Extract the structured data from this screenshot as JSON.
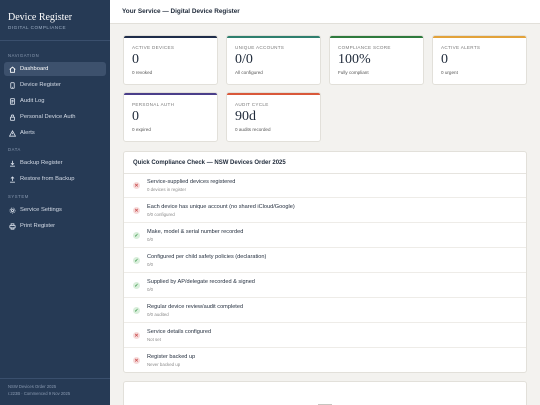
{
  "brand": {
    "title": "Device Register",
    "subtitle": "DIGITAL COMPLIANCE"
  },
  "nav_sections": {
    "navigation": "NAVIGATION",
    "data": "DATA",
    "system": "SYSTEM"
  },
  "nav": {
    "dashboard": "Dashboard",
    "device_register": "Device Register",
    "audit_log": "Audit Log",
    "personal_auth": "Personal Device Auth",
    "alerts": "Alerts",
    "backup": "Backup Register",
    "restore": "Restore from Backup",
    "settings": "Service Settings",
    "print": "Print Register"
  },
  "footer": {
    "line1": "NSW Devices Order 2025",
    "line2": "r.223B · Commenced 9 Nov 2025"
  },
  "header": {
    "title": "Your Service — Digital Device Register"
  },
  "cards": {
    "active_devices": {
      "label": "ACTIVE DEVICES",
      "value": "0",
      "sub": "0 revoked",
      "accent": "#1f2d4a"
    },
    "unique_accounts": {
      "label": "UNIQUE ACCOUNTS",
      "value": "0/0",
      "sub": "All configured",
      "accent": "#2f7f6e"
    },
    "compliance_score": {
      "label": "COMPLIANCE SCORE",
      "value": "100%",
      "sub": "Fully compliant",
      "accent": "#2e7a3d"
    },
    "active_alerts": {
      "label": "ACTIVE ALERTS",
      "value": "0",
      "sub": "0 urgent",
      "accent": "#e2a23a"
    },
    "personal_auth": {
      "label": "PERSONAL AUTH",
      "value": "0",
      "sub": "0 expired",
      "accent": "#4a3e8a"
    },
    "audit_cycle": {
      "label": "AUDIT CYCLE",
      "value": "90d",
      "sub": "0 audits recorded",
      "accent": "#d9583a"
    }
  },
  "checklist": {
    "title": "Quick Compliance Check — NSW Devices Order 2025",
    "items": [
      {
        "title": "Service-supplied devices registered",
        "sub": "0 devices in register",
        "status": "bad"
      },
      {
        "title": "Each device has unique account (no shared iCloud/Google)",
        "sub": "0/0 configured",
        "status": "bad"
      },
      {
        "title": "Make, model & serial number recorded",
        "sub": "0/0",
        "status": "ok"
      },
      {
        "title": "Configured per child safety policies (declaration)",
        "sub": "0/0",
        "status": "ok"
      },
      {
        "title": "Supplied by AP/delegate recorded & signed",
        "sub": "0/0",
        "status": "ok"
      },
      {
        "title": "Regular device review/audit completed",
        "sub": "0/0 audited",
        "status": "ok"
      },
      {
        "title": "Service details configured",
        "sub": "Not set",
        "status": "bad"
      },
      {
        "title": "Register backed up",
        "sub": "Never backed up",
        "status": "bad"
      }
    ]
  }
}
